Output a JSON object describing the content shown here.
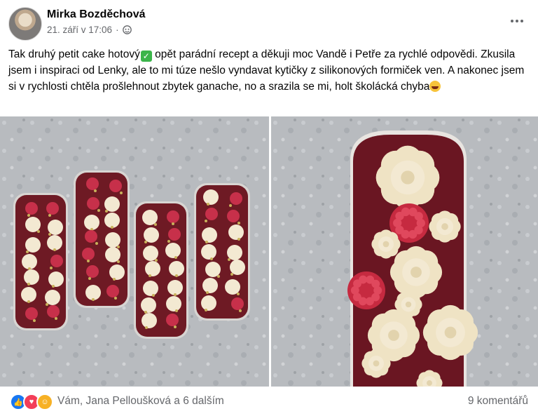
{
  "post": {
    "author": "Mirka Bozděchová",
    "timestamp": "21. září v 17:06",
    "privacy_icon": "friends-globe-icon",
    "text_1": "Tak druhý petit cake hotový",
    "text_2": " opět parádní recept a děkuji moc Vandě i Petře za rychlé odpovědi. Zkusila jsem i inspiraci od Lenky, ale to mi túze nešlo vyndavat kytičky z silikonových formiček ven. A nakonec jsem si v rychlosti chtěla prošlehnout zbytek ganache, no a srazila se mi, holt školácká chyba"
  },
  "footer": {
    "reactions": [
      "like",
      "love",
      "care"
    ],
    "reaction_names": "Vám, Jana Pelloušková a 6 dalším",
    "comments": "9 komentářů"
  },
  "colors": {
    "concrete": "#b9bcc0",
    "cake": "#6e1a24",
    "cream": "#f3e9d2",
    "raspberry": "#c7304a",
    "pistachio": "#c9b15a"
  }
}
